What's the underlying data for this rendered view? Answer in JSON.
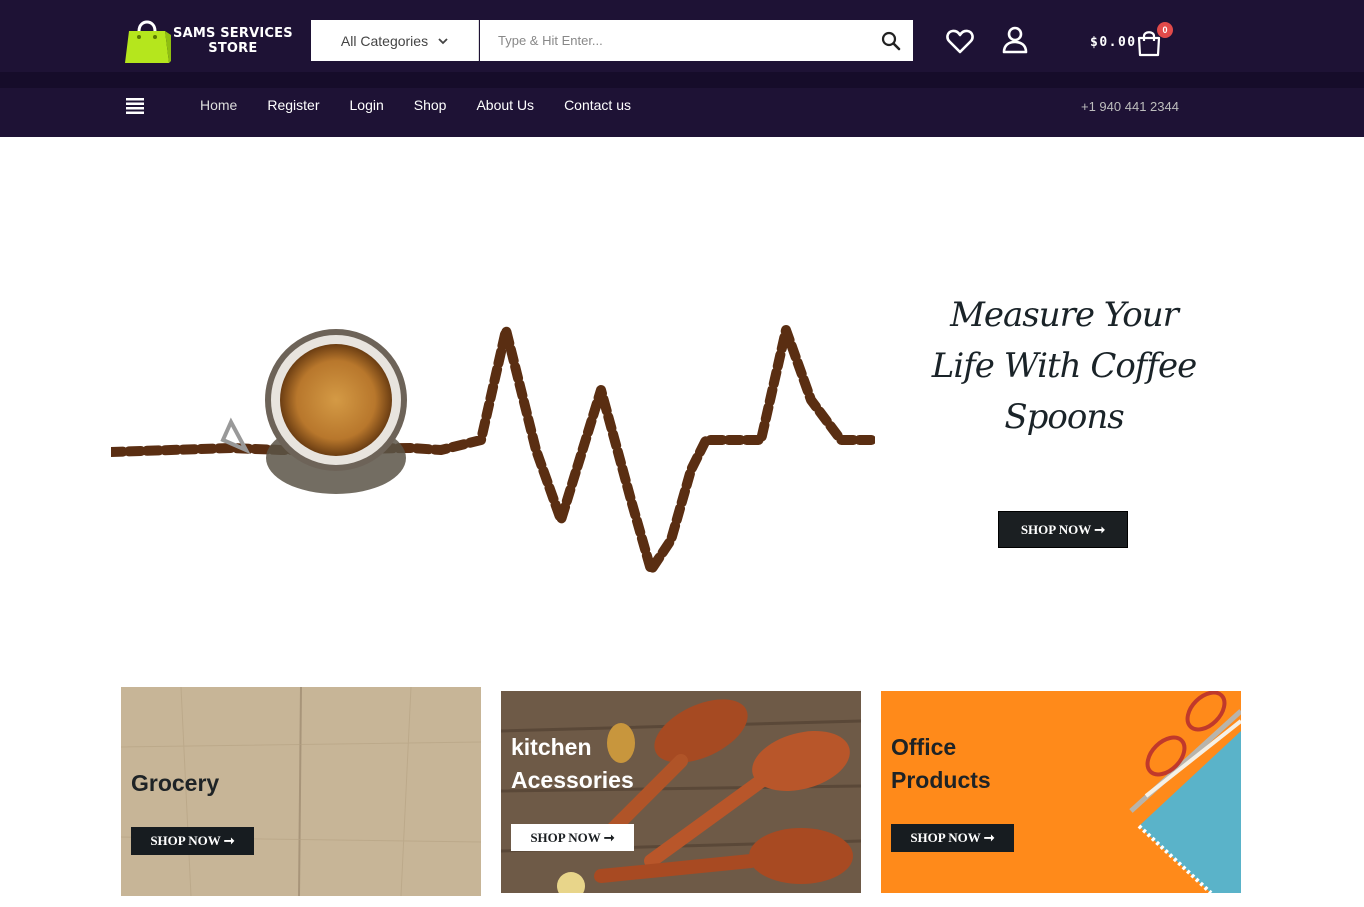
{
  "header": {
    "logo_line1": "SAMS SERVICES",
    "logo_line2": "STORE",
    "category_label": "All Categories",
    "search_placeholder": "Type & Hit Enter...",
    "cart_amount": "$0.00",
    "cart_count": "0"
  },
  "nav": {
    "items": [
      "Home",
      "Register",
      "Login",
      "Shop",
      "About Us",
      "Contact us"
    ],
    "phone": "+1 940 441 2344"
  },
  "hero": {
    "title_line1": "Measure Your",
    "title_line2": "Life With Coffee",
    "title_line3": "Spoons",
    "button_label": "SHOP NOW ➞"
  },
  "cards": [
    {
      "title_line1": "Grocery",
      "title_line2": "",
      "button_label": "SHOP NOW ➞"
    },
    {
      "title_line1": "kitchen",
      "title_line2": "Acessories",
      "button_label": "SHOP NOW ➞"
    },
    {
      "title_line1": "Office",
      "title_line2": "Products",
      "button_label": "SHOP NOW ➞"
    }
  ],
  "colors": {
    "header_bg": "#1e1235",
    "logo_bag": "#b5e61d",
    "badge": "#e24a4a",
    "office_bg": "#ff8c1c"
  },
  "icons": [
    "shopping-bag-logo-icon",
    "chevron-down-icon",
    "search-icon",
    "heart-icon",
    "user-icon",
    "cart-icon",
    "hamburger-menu-icon"
  ]
}
